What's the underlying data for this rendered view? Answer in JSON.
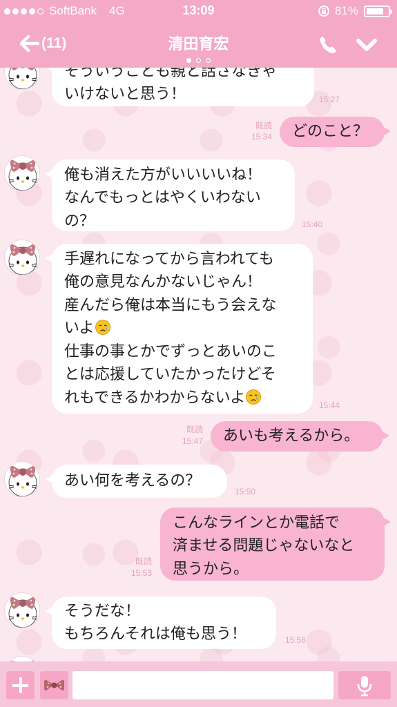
{
  "status_bar": {
    "carrier": "SoftBank",
    "network": "4G",
    "time": "13:09",
    "battery": "81%",
    "battery_level": 0.81,
    "signal_dots_filled": 4
  },
  "header": {
    "back_label": "(11)",
    "title": "清田育宏",
    "page_dots": 3,
    "active_page": 1,
    "call_icon": "phone-icon",
    "menu_icon": "chevron-down-icon"
  },
  "colors": {
    "accent": "#f4a9c6",
    "outgoing_bubble": "#f8b4d1",
    "incoming_bubble": "#ffffff",
    "background": "#fbe9ef",
    "meta_text": "#e7a3bd"
  },
  "messages": [
    {
      "direction": "in",
      "lines": [
        "そういうことも親と話さなきゃ",
        "いけないと思う！"
      ],
      "time": "15:27",
      "read": ""
    },
    {
      "direction": "out",
      "lines": [
        "どのこと？"
      ],
      "time": "15:34",
      "read": "既読"
    },
    {
      "direction": "in",
      "lines": [
        "俺も消えた方がいいいいね！",
        "なんでもっとはやくいわない",
        "の？"
      ],
      "time": "15:40",
      "read": ""
    },
    {
      "direction": "in",
      "lines": [
        "手遅れになってから言われても",
        "俺の意見なんかないじゃん！",
        "産んだら俺は本当にもう会えな",
        "いよ",
        "仕事の事とかでずっとあいのこ",
        "とは応援していたかったけどそ",
        "れもできるかわからないよ"
      ],
      "time": "15:44",
      "read": ""
    },
    {
      "direction": "out",
      "lines": [
        "あいも考えるから。"
      ],
      "time": "15:47",
      "read": "既読"
    },
    {
      "direction": "in",
      "lines": [
        "あい何を考えるの？"
      ],
      "time": "15:50",
      "read": ""
    },
    {
      "direction": "out",
      "lines": [
        "こんなラインとか電話で",
        "済ませる問題じゃないなと",
        "思うから。"
      ],
      "time": "15:53",
      "read": "既読"
    },
    {
      "direction": "in",
      "lines": [
        "そうだな！",
        "もちろんそれは俺も思う！"
      ],
      "time": "15:56",
      "read": ""
    }
  ],
  "input_bar": {
    "plus_icon": "plus-icon",
    "sticker_icon": "sticker-icon",
    "mic_icon": "mic-icon",
    "message_value": "",
    "placeholder": ""
  }
}
